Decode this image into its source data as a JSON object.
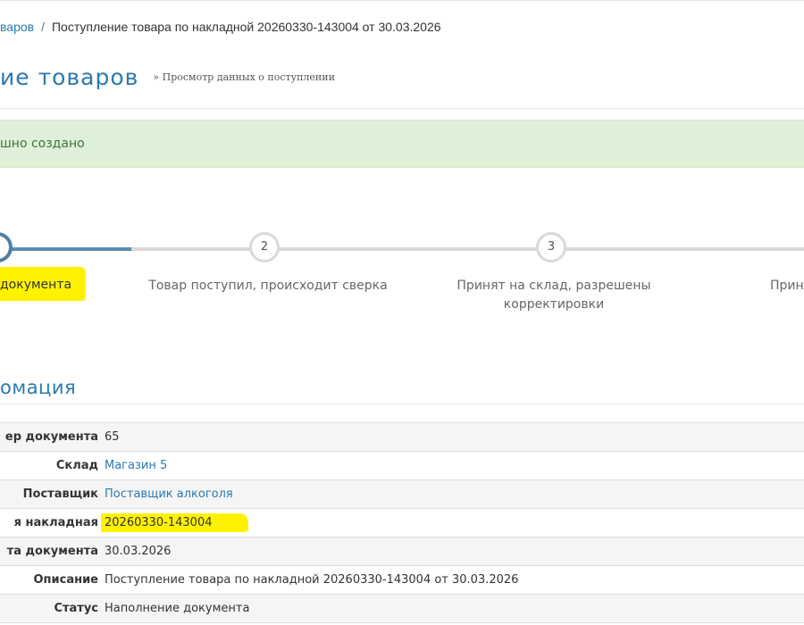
{
  "breadcrumb": {
    "parent_label": "варов",
    "separator": "/",
    "current_label": "Поступление товара по накладной 20260330-143004 от 30.03.2026"
  },
  "page": {
    "title": "ие товаров",
    "subtitle": "» Просмотр данных о поступлении"
  },
  "alert": {
    "text": "шно создано"
  },
  "stepper": {
    "steps": [
      {
        "number": "",
        "label": "документа",
        "state": "active"
      },
      {
        "number": "2",
        "label": "Товар поступил, происходит сверка",
        "state": "pending"
      },
      {
        "number": "3",
        "label": "Принят на склад, разрешены корректировки",
        "state": "pending"
      },
      {
        "number": "",
        "label": "Прин",
        "state": "pending"
      }
    ],
    "progress": 0.16
  },
  "section": {
    "title": "омация"
  },
  "info": {
    "rows": [
      {
        "key": "ер документа",
        "value": "65"
      },
      {
        "key": "Склад",
        "value": "Магазин 5"
      },
      {
        "key": "Поставщик",
        "value": "Поставщик алкоголя"
      },
      {
        "key": "я накладная",
        "value": "20260330-143004"
      },
      {
        "key": "та документа",
        "value": "30.03.2026"
      },
      {
        "key": "Описание",
        "value": "Поступление товара по накладной 20260330-143004 от 30.03.2026"
      },
      {
        "key": "Статус",
        "value": "Наполнение документа"
      }
    ]
  },
  "colors": {
    "accent": "#2a7ab0",
    "success_bg": "#dff0d8",
    "success_text": "#3c763d",
    "highlight": "#fff200",
    "step_done": "#5a8db5"
  }
}
